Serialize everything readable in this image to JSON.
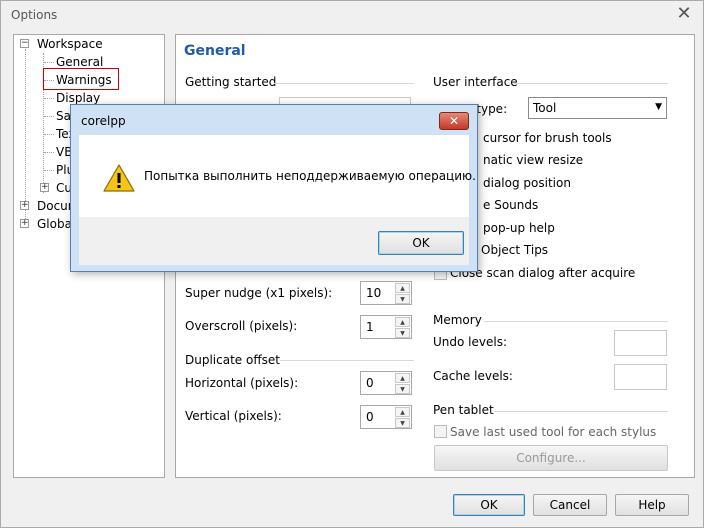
{
  "window": {
    "title": "Options",
    "close_symbol": "✕"
  },
  "tree": {
    "items": [
      {
        "label": "Workspace",
        "expander": "−"
      },
      {
        "label": "General"
      },
      {
        "label": "Warnings"
      },
      {
        "label": "Display"
      },
      {
        "label": "Save"
      },
      {
        "label": "Text"
      },
      {
        "label": "VBA"
      },
      {
        "label": "Plug-ins"
      },
      {
        "label": "Customization",
        "expander": "+"
      },
      {
        "label": "Document",
        "expander": "+"
      },
      {
        "label": "Global",
        "expander": "+"
      }
    ]
  },
  "panel": {
    "title": "General",
    "getting_started": {
      "heading": "Getting started"
    },
    "super_nudge": {
      "label": "Super nudge (x1 pixels):",
      "value": "10"
    },
    "overscroll": {
      "label": "Overscroll (pixels):",
      "value": "1"
    },
    "duplicate_offset": {
      "heading": "Duplicate offset",
      "horizontal": {
        "label": "Horizontal (pixels):",
        "value": "0"
      },
      "vertical": {
        "label": "Vertical (pixels):",
        "value": "0"
      }
    },
    "user_interface": {
      "heading": "User interface",
      "cursor_label": "Cursor type:",
      "cursor_value": "Tool",
      "options": [
        "cursor for brush tools",
        "natic view resize",
        "dialog position",
        "e Sounds",
        "pop-up help",
        "Object Tips",
        "Close scan dialog after acquire"
      ]
    },
    "memory": {
      "heading": "Memory",
      "undo_label": "Undo levels:",
      "cache_label": "Cache levels:"
    },
    "pen_tablet": {
      "heading": "Pen tablet",
      "save_last": "Save last used tool for each stylus",
      "configure": "Configure..."
    }
  },
  "footer": {
    "ok": "OK",
    "cancel": "Cancel",
    "help": "Help"
  },
  "modal": {
    "title": "corelpp",
    "message": "Попытка выполнить неподдерживаемую операцию.",
    "ok": "OK",
    "close_symbol": "✕"
  }
}
